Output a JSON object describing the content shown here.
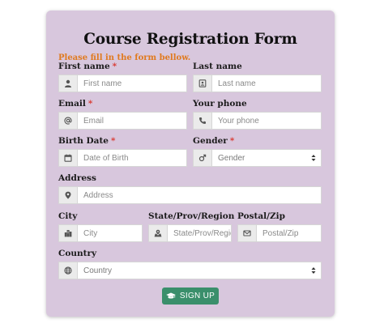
{
  "form": {
    "title": "Course Registration Form",
    "subtitle": "Please fill in the form bellow.",
    "required_marker": "*",
    "fields": {
      "first_name": {
        "label": "First name",
        "placeholder": "First name",
        "icon": "user-icon"
      },
      "last_name": {
        "label": "Last name",
        "placeholder": "Last name",
        "icon": "id-card-icon"
      },
      "email": {
        "label": "Email",
        "placeholder": "Email",
        "icon": "at-icon"
      },
      "phone": {
        "label": "Your phone",
        "placeholder": "Your phone",
        "icon": "phone-icon"
      },
      "birth_date": {
        "label": "Birth Date",
        "placeholder": "Date of Birth",
        "icon": "calendar-icon"
      },
      "gender": {
        "label": "Gender",
        "selected": "Gender",
        "icon": "mars-icon"
      },
      "address": {
        "label": "Address",
        "placeholder": "Address",
        "icon": "map-marker-icon"
      },
      "city": {
        "label": "City",
        "placeholder": "City",
        "icon": "city-icon"
      },
      "state": {
        "label": "State/Prov/Region",
        "placeholder": "State/Prov/Region",
        "icon": "map-icon"
      },
      "postal": {
        "label": "Postal/Zip",
        "placeholder": "Postal/Zip",
        "icon": "envelope-icon"
      },
      "country": {
        "label": "Country",
        "selected": "Country",
        "icon": "globe-icon"
      }
    },
    "submit_label": "SIGN UP",
    "submit_icon": "graduation-cap-icon"
  },
  "colors": {
    "card_background": "#d8c7dd",
    "subtitle": "#e07a1f",
    "required": "#d9342b",
    "button": "#3a8f6b"
  }
}
